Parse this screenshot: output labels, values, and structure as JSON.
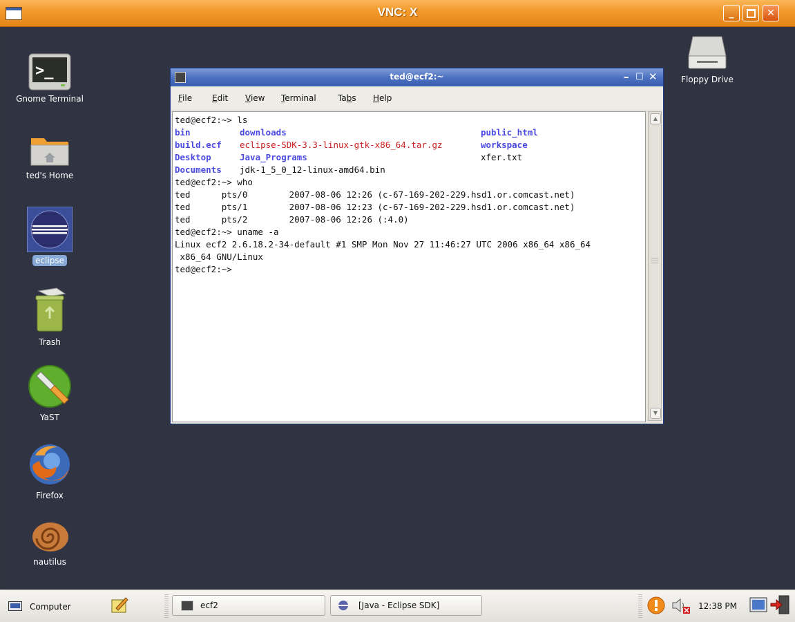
{
  "vnc_window": {
    "title": "VNC: X",
    "buttons": {
      "minimize": "minimize",
      "maximize": "maximize",
      "close": "close"
    }
  },
  "desktop_icons_left": [
    {
      "label": "Gnome Terminal",
      "icon": "terminal-icon"
    },
    {
      "label": "ted's Home",
      "icon": "home-folder-icon"
    },
    {
      "label": "eclipse",
      "icon": "eclipse-icon"
    },
    {
      "label": "Trash",
      "icon": "trash-icon"
    },
    {
      "label": "YaST",
      "icon": "yast-icon"
    },
    {
      "label": "Firefox",
      "icon": "firefox-icon"
    },
    {
      "label": "nautilus",
      "icon": "nautilus-icon"
    }
  ],
  "desktop_icons_right": [
    {
      "label": "Floppy Drive",
      "icon": "floppy-drive-icon"
    }
  ],
  "terminal": {
    "title": "ted@ecf2:~",
    "menu": [
      {
        "underline": "F",
        "rest": "ile"
      },
      {
        "underline": "E",
        "rest": "dit"
      },
      {
        "underline": "V",
        "rest": "iew"
      },
      {
        "underline": "T",
        "rest": "erminal"
      },
      {
        "pre": "Ta",
        "underline": "b",
        "rest": "s"
      },
      {
        "underline": "H",
        "rest": "elp"
      }
    ],
    "lines": [
      {
        "cells": [
          {
            "text": "ted@ecf2:~> ls",
            "style": "plain"
          }
        ]
      },
      {
        "cells": [
          {
            "text": "bin",
            "style": "blue",
            "col": 0
          },
          {
            "text": "downloads",
            "style": "blue",
            "col": 1
          },
          {
            "text": "public_html",
            "style": "blue",
            "col": 3
          }
        ]
      },
      {
        "cells": [
          {
            "text": "build.ecf",
            "style": "blue",
            "col": 0
          },
          {
            "text": "eclipse-SDK-3.3-linux-gtk-x86_64.tar.gz",
            "style": "red",
            "col": 1
          },
          {
            "text": "workspace",
            "style": "blue",
            "col": 3
          }
        ]
      },
      {
        "cells": [
          {
            "text": "Desktop",
            "style": "blue",
            "col": 0
          },
          {
            "text": "Java_Programs",
            "style": "blue",
            "col": 1
          },
          {
            "text": "xfer.txt",
            "style": "plain",
            "col": 3
          }
        ]
      },
      {
        "cells": [
          {
            "text": "Documents",
            "style": "blue",
            "col": 0
          },
          {
            "text": "jdk-1_5_0_12-linux-amd64.bin",
            "style": "plain",
            "col": 1
          }
        ]
      },
      {
        "cells": [
          {
            "text": "ted@ecf2:~> who",
            "style": "plain"
          }
        ]
      },
      {
        "cells": [
          {
            "text": "ted      pts/0        2007-08-06 12:26 (c-67-169-202-229.hsd1.or.comcast.net)",
            "style": "plain"
          }
        ]
      },
      {
        "cells": [
          {
            "text": "ted      pts/1        2007-08-06 12:23 (c-67-169-202-229.hsd1.or.comcast.net)",
            "style": "plain"
          }
        ]
      },
      {
        "cells": [
          {
            "text": "ted      pts/2        2007-08-06 12:26 (:4.0)",
            "style": "plain"
          }
        ]
      },
      {
        "cells": [
          {
            "text": "ted@ecf2:~> uname -a",
            "style": "plain"
          }
        ]
      },
      {
        "cells": [
          {
            "text": "Linux ecf2 2.6.18.2-34-default #1 SMP Mon Nov 27 11:46:27 UTC 2006 x86_64 x86_64",
            "style": "plain"
          }
        ]
      },
      {
        "cells": [
          {
            "text": " x86_64 GNU/Linux",
            "style": "plain"
          }
        ]
      },
      {
        "cells": [
          {
            "text": "ted@ecf2:~>",
            "style": "plain"
          }
        ]
      }
    ]
  },
  "panel": {
    "computer_label": "Computer",
    "tasks": [
      {
        "label": "ecf2",
        "icon": "terminal-icon"
      },
      {
        "label": "[Java - Eclipse SDK]",
        "icon": "eclipse-icon"
      }
    ],
    "clock": "12:38 PM"
  }
}
